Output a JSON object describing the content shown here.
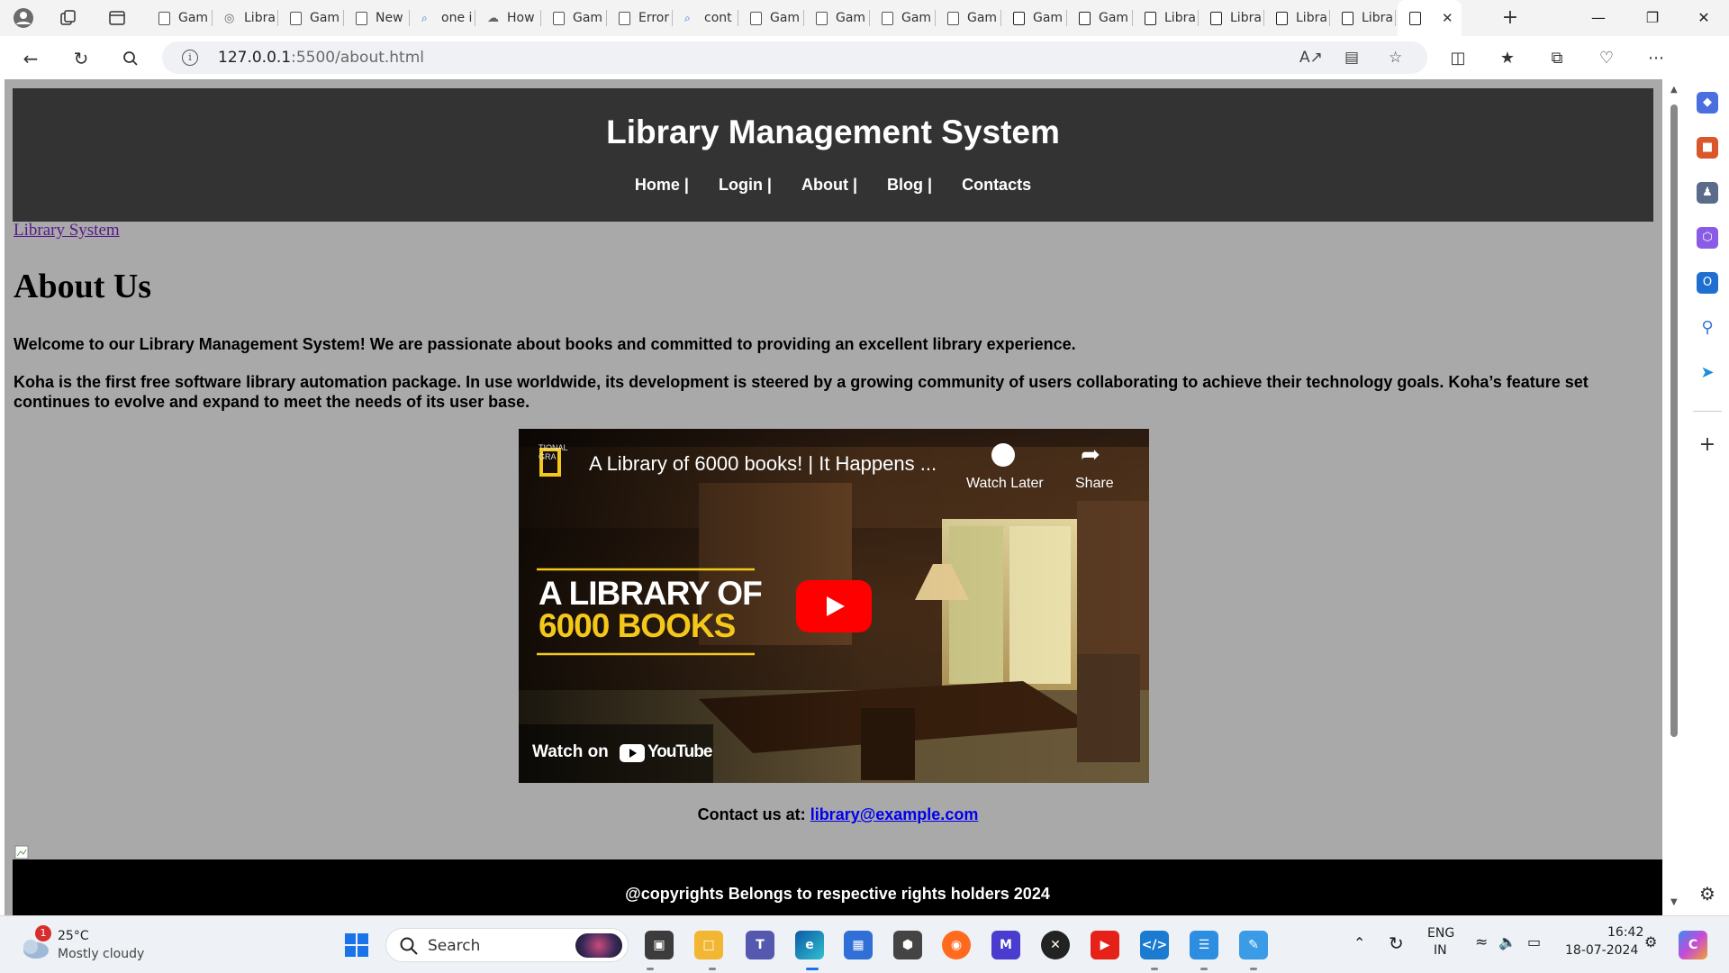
{
  "browser": {
    "tabs": [
      {
        "label": "Gam",
        "icon": "page-icon"
      },
      {
        "label": "Libra",
        "icon": "globe-icon"
      },
      {
        "label": "Gam",
        "icon": "page-icon"
      },
      {
        "label": "New",
        "icon": "newtab-icon"
      },
      {
        "label": "one i",
        "icon": "search-icon"
      },
      {
        "label": "How",
        "icon": "cloud-icon"
      },
      {
        "label": "Gam",
        "icon": "page-icon"
      },
      {
        "label": "Error",
        "icon": "page-icon"
      },
      {
        "label": "cont",
        "icon": "search-icon"
      },
      {
        "label": "Gam",
        "icon": "page-icon"
      },
      {
        "label": "Gam",
        "icon": "page-icon"
      },
      {
        "label": "Gam",
        "icon": "page-icon"
      },
      {
        "label": "Gam",
        "icon": "page-icon"
      },
      {
        "label": "Gam",
        "icon": "page-icon"
      },
      {
        "label": "Gam",
        "icon": "page-icon"
      },
      {
        "label": "Libra",
        "icon": "page-icon"
      },
      {
        "label": "Libra",
        "icon": "page-icon"
      },
      {
        "label": "Libra",
        "icon": "page-icon"
      },
      {
        "label": "Libra",
        "icon": "page-icon"
      }
    ],
    "address": {
      "host": "127.0.0.1",
      "rest": ":5500/about.html"
    }
  },
  "page": {
    "site_title": "Library Management System",
    "nav": [
      "Home |",
      "Login |",
      "About |",
      "Blog |",
      "Contacts"
    ],
    "home_link": "Library System",
    "heading": "About Us",
    "para1": "Welcome to our Library Management System! We are passionate about books and committed to providing an excellent library experience.",
    "para2": "Koha is the first free software library automation package. In use worldwide, its development is steered by a growing community of users collaborating to achieve their technology goals. Koha’s feature set continues to evolve and expand to meet the needs of its user base.",
    "video": {
      "title": "A Library of 6000 books! | It Happens ...",
      "channel_logo_text": "TIONAL GRA",
      "watch_later": "Watch Later",
      "share": "Share",
      "overlay_line1": "A LIBRARY OF",
      "overlay_line2": "6000 BOOKS",
      "watch_on": "Watch on",
      "youtube": "YouTube"
    },
    "contact_label": "Contact us at:",
    "contact_email": "library@example.com",
    "footer": "@copyrights Belongs to respective rights holders 2024"
  },
  "taskbar": {
    "weather_temp": "25°C",
    "weather_desc": "Mostly cloudy",
    "weather_badge": "1",
    "search_label": "Search",
    "lang_line1": "ENG",
    "lang_line2": "IN",
    "time": "16:42",
    "date": "18-07-2024"
  },
  "colors": {
    "page_bg": "#a9a9a9",
    "header_bg": "#333333",
    "footer_bg": "#000000",
    "link": "#0000ee",
    "visited_link": "#551a8b"
  }
}
